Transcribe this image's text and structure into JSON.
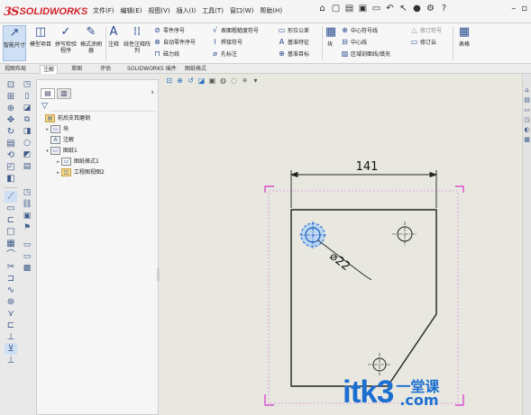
{
  "app": {
    "logo_ds": "3S",
    "logo_name": "SOLIDWORKS"
  },
  "menu": [
    "文件(F)",
    "编辑(E)",
    "视图(V)",
    "插入(I)",
    "工具(T)",
    "窗口(W)",
    "帮助(H)"
  ],
  "ribbon": {
    "smart_dimension": "智能尺寸",
    "model_items": "模型项目",
    "spell_check": "拼写检验程序",
    "format_painter": "格式涂刷器",
    "note": "注释",
    "linear_note_pattern": "线性注释阵列",
    "balloon": "零件序号",
    "auto_balloon": "自动零件序号",
    "magnetic_line": "磁力线",
    "surface_finish": "表面粗糙度符号",
    "weld_symbol": "焊接符号",
    "hole_callout": "孔标注",
    "geometric_tolerance": "形位公差",
    "datum_feature": "基准特征",
    "datum_target": "基准目标",
    "blocks": "块",
    "center_mark": "中心符号线",
    "centerline": "中心线",
    "area_hatch": "区域剖面线/填充",
    "revision_symbol": "修订符号",
    "revision_cloud": "修订云",
    "tables": "表格"
  },
  "tabs": [
    "视图布局",
    "注解",
    "草图",
    "评估",
    "SOLIDWORKS 插件",
    "图纸格式"
  ],
  "active_tab": "注解",
  "tree": {
    "root": "前后支耳磨钢",
    "items": [
      {
        "label": "块",
        "level": 1,
        "expander": "▸"
      },
      {
        "label": "注解",
        "level": 1,
        "expander": ""
      },
      {
        "label": "图纸1",
        "level": 1,
        "expander": "▾"
      },
      {
        "label": "图纸格式1",
        "level": 2,
        "expander": "▸"
      },
      {
        "label": "工程图视图2",
        "level": 2,
        "expander": "▸"
      }
    ]
  },
  "drawing": {
    "dimension_width": "141",
    "dimension_hole": "⌀22"
  },
  "watermark": {
    "brand": "itk3",
    "chinese": "一堂课",
    "domain": ".com"
  }
}
